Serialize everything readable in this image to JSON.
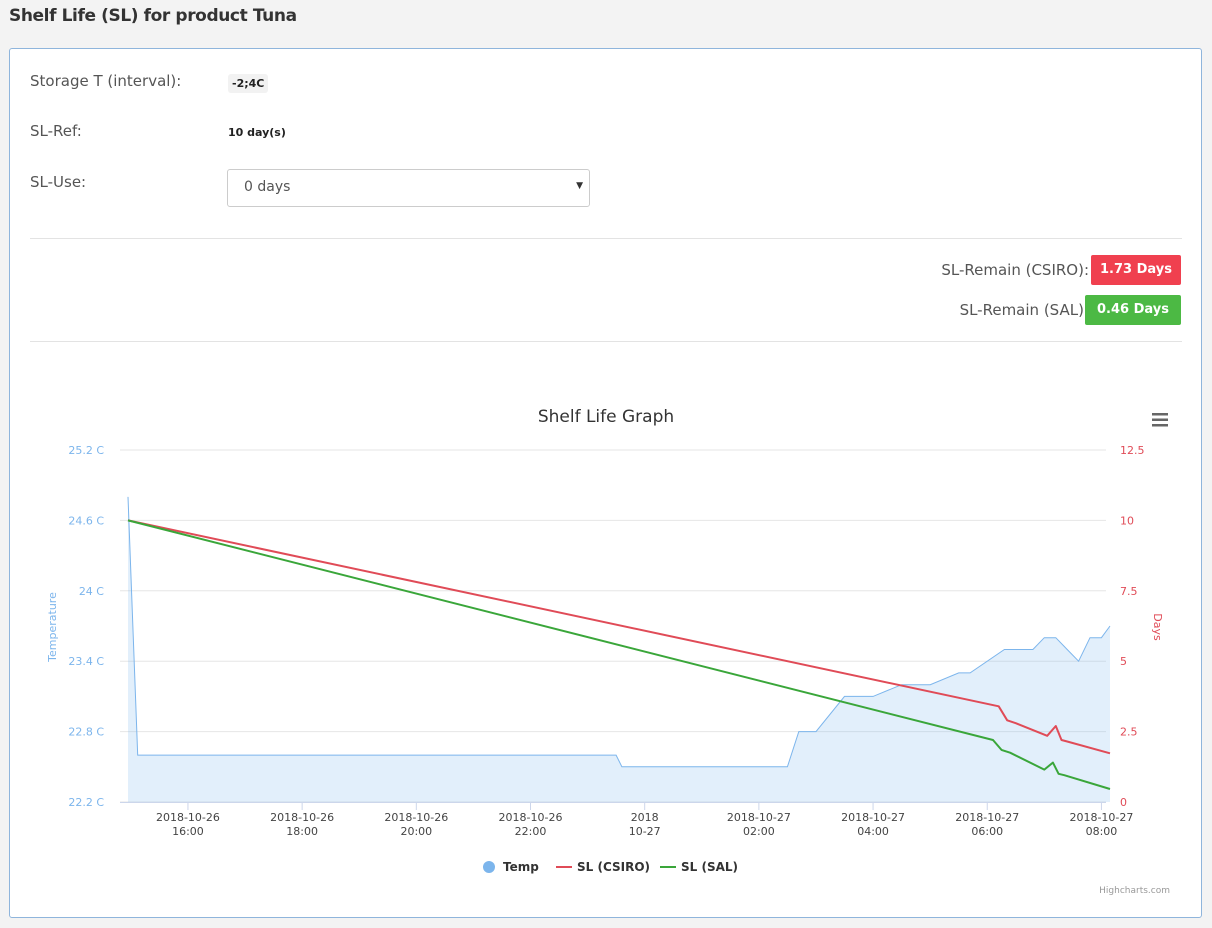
{
  "page": {
    "title": "Shelf Life (SL) for product Tuna"
  },
  "info": {
    "storage_label": "Storage T (interval):",
    "storage_value": "-2;4C",
    "slref_label": "SL-Ref:",
    "slref_value": "10 day(s)",
    "sluse_label": "SL-Use:",
    "sluse_selected": "0 days"
  },
  "remain": {
    "csiro_label": "SL-Remain (CSIRO):",
    "csiro_value": "1.73 Days",
    "csiro_color": "#f0404f",
    "sal_label": "SL-Remain (SAL):",
    "sal_value": "0.46 Days",
    "sal_color": "#4cb944"
  },
  "menu_icon": "hamburger-menu-icon",
  "chart_data": {
    "type": "line",
    "title": "Shelf Life Graph",
    "y_left": {
      "label": "Temperature",
      "ticks": [
        "22.2 C",
        "22.8 C",
        "23.4 C",
        "24 C",
        "24.6 C",
        "25.2 C"
      ],
      "range": [
        22.2,
        25.2
      ]
    },
    "y_right": {
      "label": "Days",
      "ticks": [
        "0",
        "2.5",
        "5",
        "7.5",
        "10",
        "12.5"
      ],
      "range": [
        0,
        12.5
      ]
    },
    "x_ticks": [
      [
        "2018-10-26",
        "16:00"
      ],
      [
        "2018-10-26",
        "18:00"
      ],
      [
        "2018-10-26",
        "20:00"
      ],
      [
        "2018-10-26",
        "22:00"
      ],
      [
        "2018",
        "10-27"
      ],
      [
        "2018-10-27",
        "02:00"
      ],
      [
        "2018-10-27",
        "04:00"
      ],
      [
        "2018-10-27",
        "06:00"
      ],
      [
        "2018-10-27",
        "08:00"
      ]
    ],
    "x_range_hours": [
      14.95,
      32.15
    ],
    "grid": true,
    "legend_position": "bottom-center",
    "credits": "Highcharts.com",
    "series": [
      {
        "name": "Temp",
        "type": "area",
        "axis": "left",
        "color": "#7cb5ec",
        "x": [
          14.95,
          15.12,
          16.0,
          18.0,
          20.0,
          22.0,
          23.5,
          23.6,
          24.0,
          26.0,
          26.5,
          26.7,
          27.0,
          27.5,
          27.7,
          28.0,
          28.5,
          28.7,
          29.0,
          29.5,
          29.7,
          30.3,
          30.5,
          30.8,
          31.0,
          31.2,
          31.4,
          31.6,
          31.8,
          32.0,
          32.15
        ],
        "y": [
          24.8,
          22.6,
          22.6,
          22.6,
          22.6,
          22.6,
          22.6,
          22.5,
          22.5,
          22.5,
          22.5,
          22.8,
          22.8,
          23.1,
          23.1,
          23.1,
          23.2,
          23.2,
          23.2,
          23.3,
          23.3,
          23.5,
          23.5,
          23.5,
          23.6,
          23.6,
          23.5,
          23.4,
          23.6,
          23.6,
          23.7
        ]
      },
      {
        "name": "SL (CSIRO)",
        "type": "line",
        "axis": "right",
        "color": "#e04b57",
        "x": [
          14.95,
          30.2,
          30.35,
          30.5,
          31.05,
          31.2,
          31.3,
          31.4,
          32.15
        ],
        "y": [
          10.0,
          3.4,
          2.9,
          2.8,
          2.35,
          2.7,
          2.2,
          2.15,
          1.73
        ]
      },
      {
        "name": "SL (SAL)",
        "type": "line",
        "axis": "right",
        "color": "#3aa63a",
        "x": [
          14.95,
          30.1,
          30.25,
          30.4,
          31.0,
          31.15,
          31.25,
          31.35,
          32.15
        ],
        "y": [
          10.0,
          2.2,
          1.85,
          1.75,
          1.15,
          1.4,
          1.0,
          0.95,
          0.46
        ]
      }
    ]
  }
}
